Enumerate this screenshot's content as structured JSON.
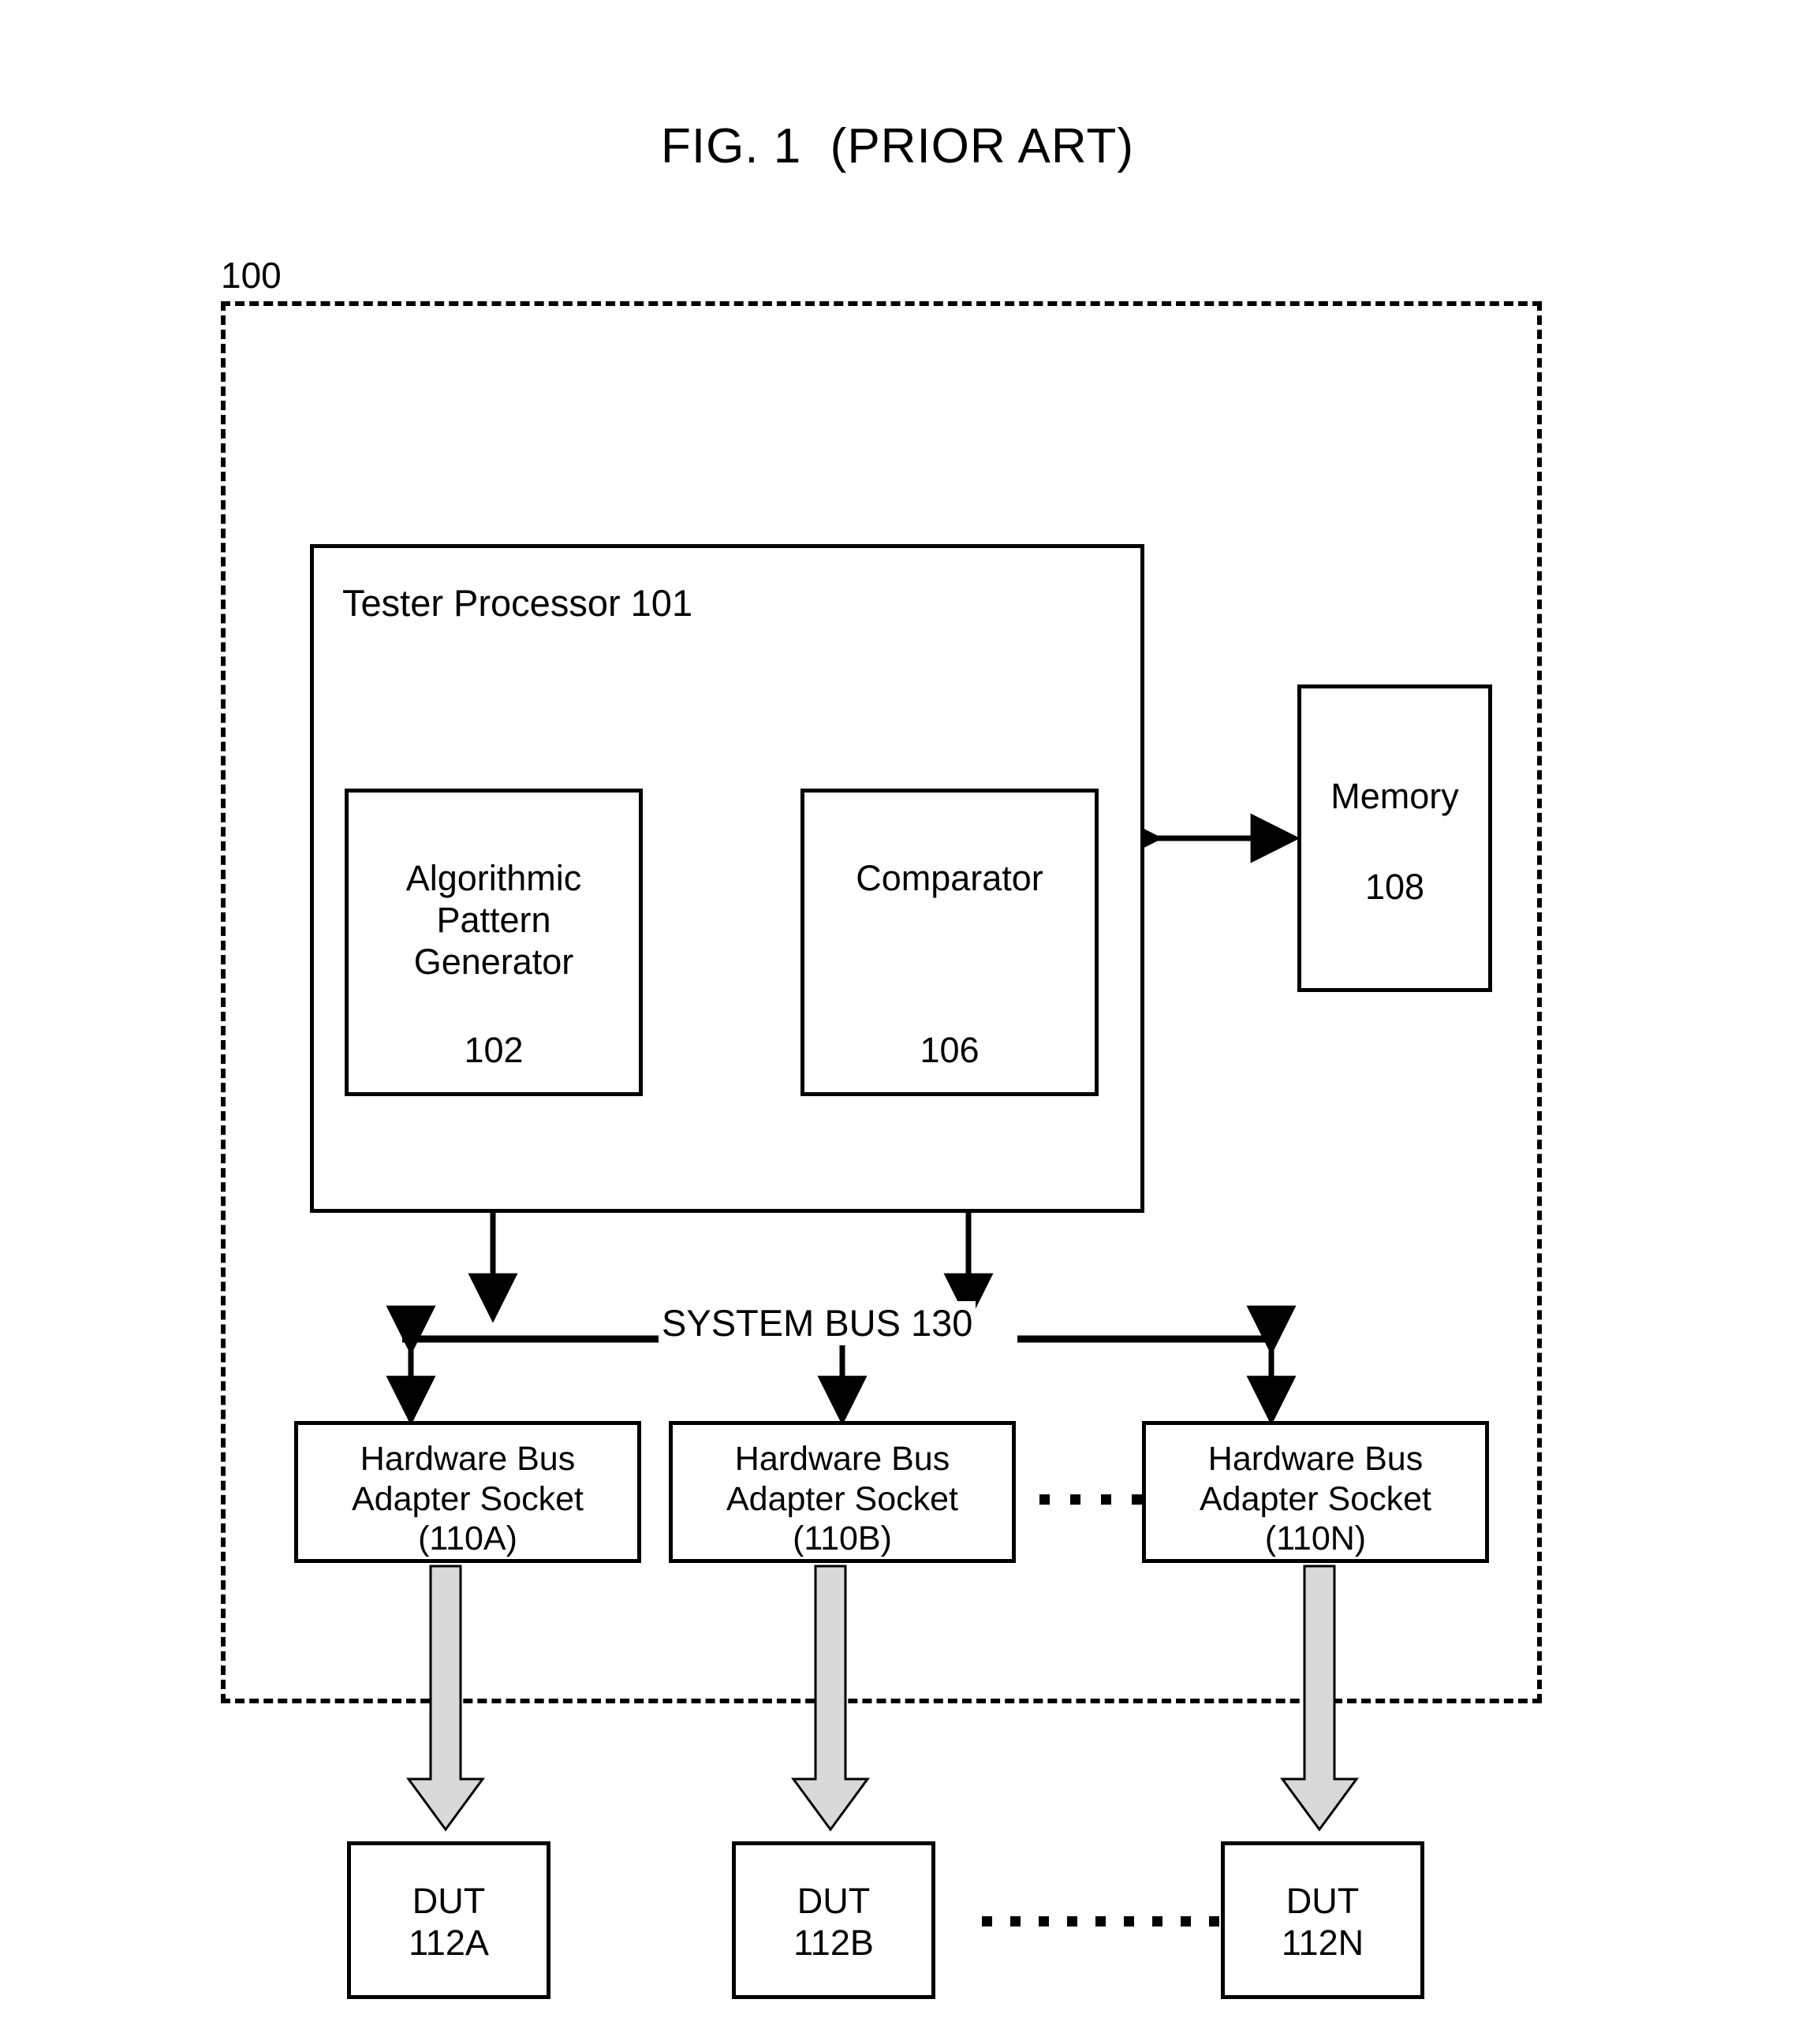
{
  "figure": {
    "title": "FIG. 1  (PRIOR ART)",
    "system_ref": "100"
  },
  "tester_processor": {
    "title": "Tester Processor 101",
    "blocks": [
      {
        "name": "Algorithmic\nPattern\nGenerator",
        "ref": "102"
      },
      {
        "name": "Comparator",
        "ref": "106"
      }
    ]
  },
  "memory": {
    "name": "Memory",
    "ref": "108"
  },
  "bus": {
    "label": "SYSTEM BUS 130"
  },
  "sockets": [
    {
      "label": "Hardware Bus\nAdapter Socket\n(110A)"
    },
    {
      "label": "Hardware Bus\nAdapter Socket\n(110B)"
    },
    {
      "label": "Hardware Bus\nAdapter Socket\n(110N)"
    }
  ],
  "duts": [
    {
      "label": "DUT\n112A"
    },
    {
      "label": "DUT\n112B"
    },
    {
      "label": "DUT\n112N"
    }
  ],
  "ellipses": {
    "socket_dot_count": 4,
    "dut_dot_count": 9
  },
  "colors": {
    "stroke": "#000000",
    "background": "#ffffff",
    "block_arrow_fill": "#d9d9d9"
  }
}
